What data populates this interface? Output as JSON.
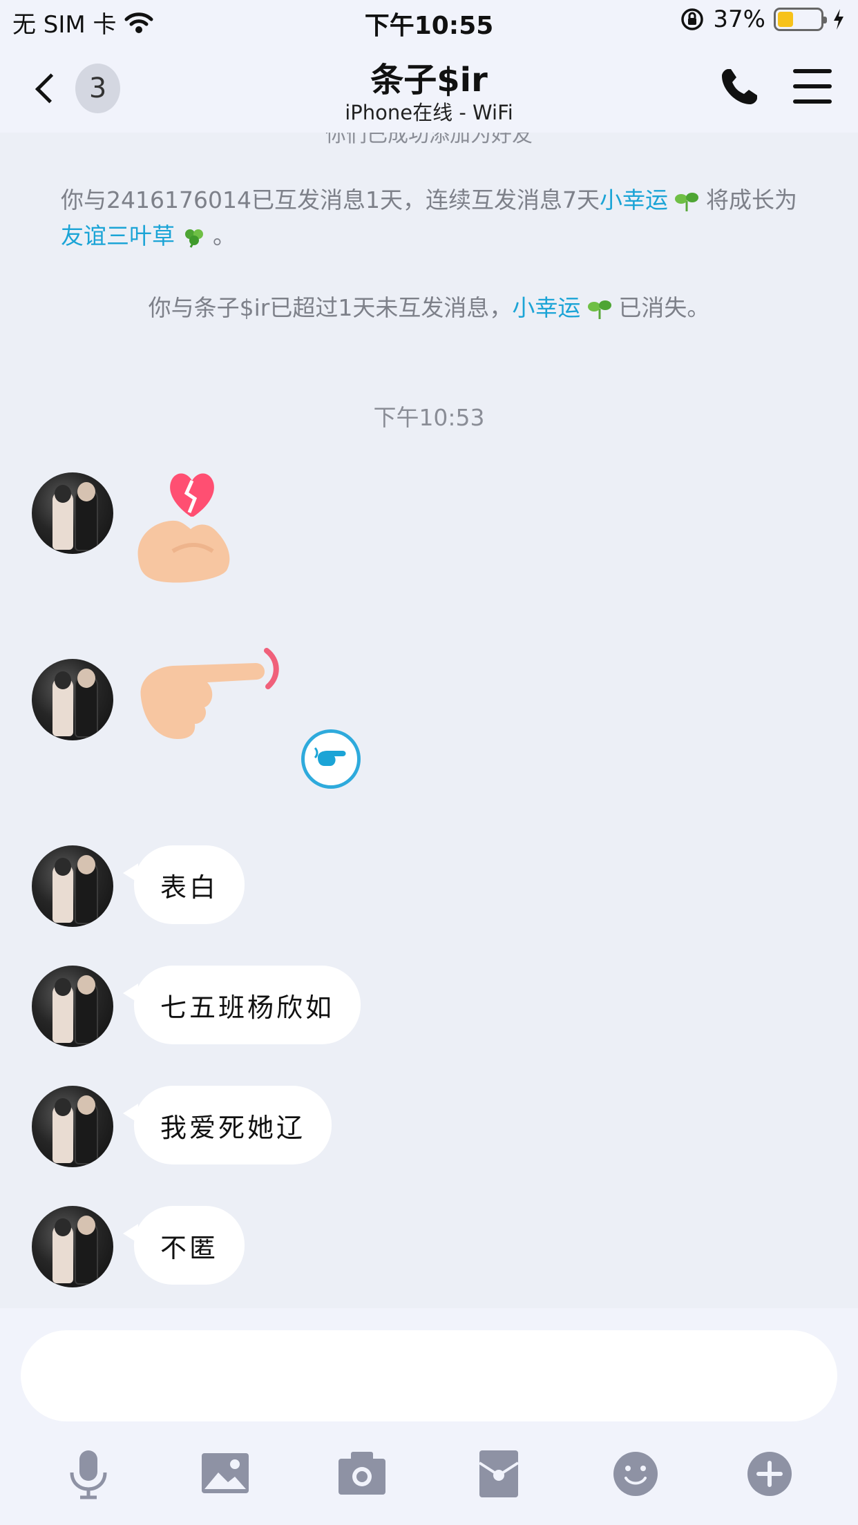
{
  "status_bar": {
    "carrier": "无 SIM 卡",
    "time": "下午10:55",
    "battery_percent": "37%",
    "battery_level": 0.37,
    "icons": [
      "wifi-icon",
      "rotation-lock-icon",
      "battery-icon",
      "charging-icon"
    ]
  },
  "nav": {
    "back_badge": "3",
    "title": "条子$ir",
    "subtitle": "iPhone在线 - WiFi",
    "icons": [
      "back-chevron-icon",
      "phone-icon",
      "menu-icon"
    ]
  },
  "system_messages": {
    "clipped_top": "你们已成功添加为好友",
    "friendship_pre": "你与2416176014已互发消息1天，连续互发消息7天",
    "friendship_link1": "小幸运",
    "friendship_mid": " 将成长为",
    "friendship_link2": "友谊三叶草",
    "friendship_end": " 。",
    "lost_pre": "你与条子$ir已超过1天未互发消息，",
    "lost_link": "小幸运",
    "lost_end": " 已消失。"
  },
  "timestamp": "下午10:53",
  "messages": [
    {
      "type": "sticker",
      "name": "broken-heart-hand-sticker"
    },
    {
      "type": "sticker",
      "name": "pointing-finger-sticker"
    },
    {
      "type": "text",
      "text": "表白"
    },
    {
      "type": "text",
      "text": "七五班杨欣如"
    },
    {
      "type": "text",
      "text": "我爱死她辽"
    },
    {
      "type": "text",
      "text": "不匿"
    }
  ],
  "input": {
    "value": "",
    "placeholder": ""
  },
  "toolbar": [
    "mic-icon",
    "image-icon",
    "camera-icon",
    "red-packet-icon",
    "emoji-icon",
    "plus-icon"
  ],
  "colors": {
    "link": "#1ba4d6",
    "toolbar_icon": "#8e92a4",
    "battery": "#f7c21a",
    "background": "#eceff6"
  }
}
